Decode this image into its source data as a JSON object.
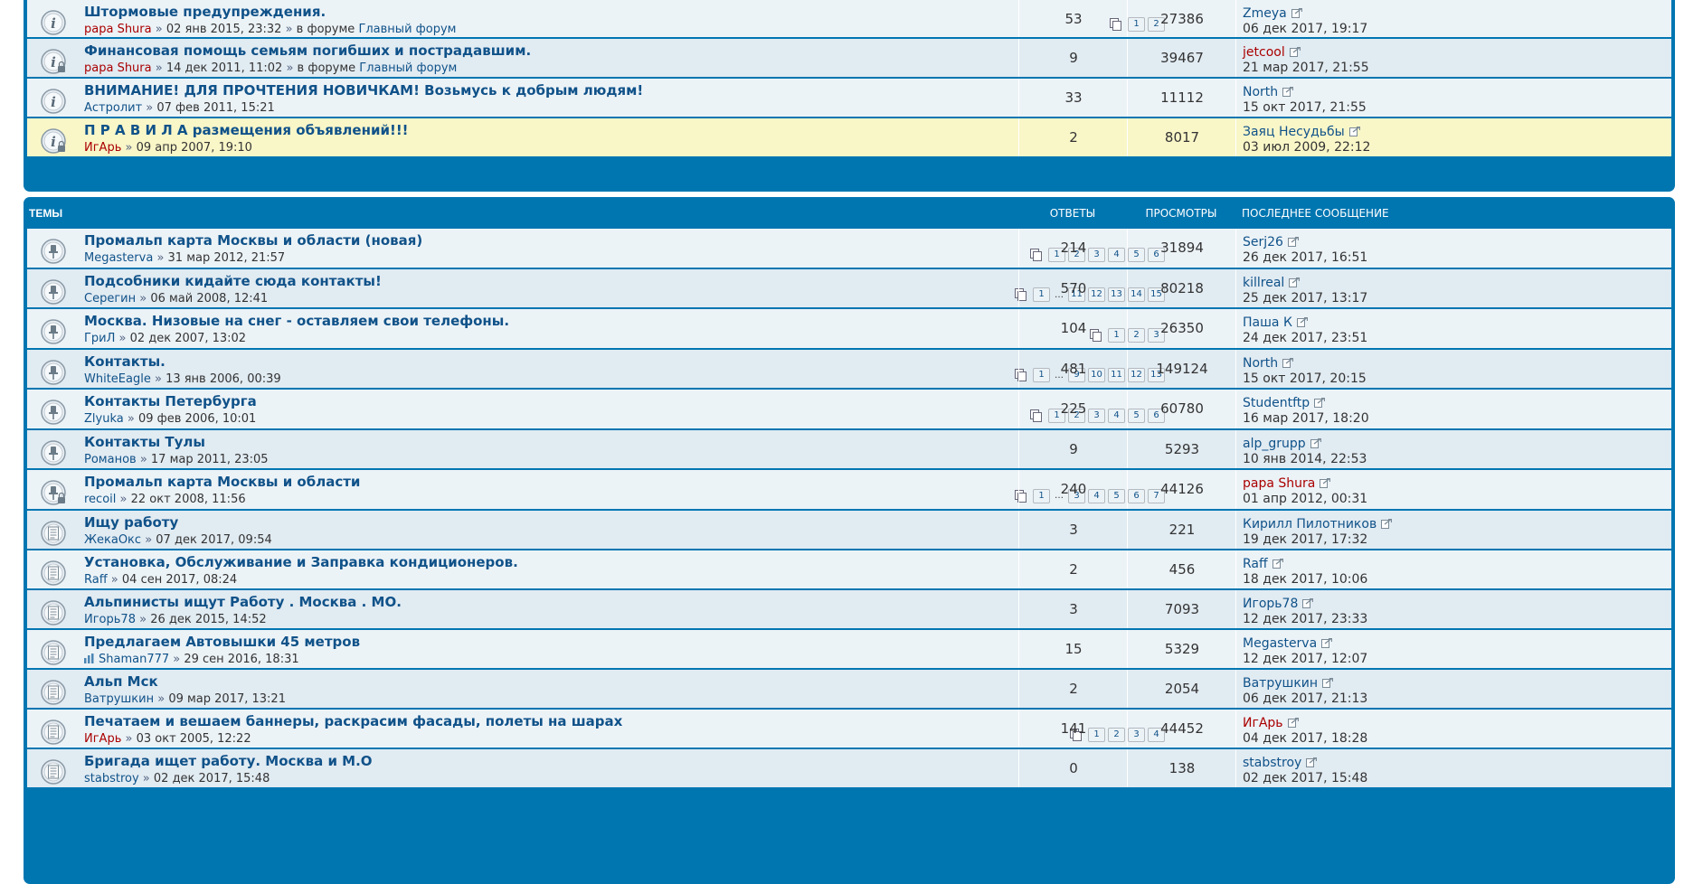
{
  "announcements": [
    {
      "title": "Штормовые предупреждения.",
      "author": "papa Shura",
      "author_red": true,
      "date": "02 янв 2015, 23:32",
      "forum_prefix": "в форуме",
      "forum": "Главный форум",
      "pages": [
        "1",
        "2"
      ],
      "replies": "53",
      "views": "27386",
      "last_user": "Zmeya",
      "last_user_red": false,
      "last_date": "06 дек 2017, 19:17",
      "icon": "announce-icon",
      "locked": false,
      "sticky": false
    },
    {
      "title": "Финансовая помощь семьям погибших и пострадавшим.",
      "author": "papa Shura",
      "author_red": true,
      "date": "14 дек 2011, 11:02",
      "forum_prefix": "в форуме",
      "forum": "Главный форум",
      "pages": [],
      "replies": "9",
      "views": "39467",
      "last_user": "jetcool",
      "last_user_red": true,
      "last_date": "21 мар 2017, 21:55",
      "icon": "announce-locked-icon",
      "locked": true,
      "sticky": false
    },
    {
      "title": "ВНИМАНИЕ! ДЛЯ ПРОЧТЕНИЯ НОВИЧКАМ! Возьмусь к добрым людям!",
      "author": "Астролит",
      "author_red": false,
      "date": "07 фев 2011, 15:21",
      "forum_prefix": "",
      "forum": "",
      "pages": [],
      "replies": "33",
      "views": "11112",
      "last_user": "North",
      "last_user_red": false,
      "last_date": "15 окт 2017, 21:55",
      "icon": "announce-icon",
      "locked": false,
      "sticky": false
    },
    {
      "title": "П Р А В И Л А размещения объявлений!!!",
      "author": "ИгАрь",
      "author_red": true,
      "date": "09 апр 2007, 19:10",
      "forum_prefix": "",
      "forum": "",
      "pages": [],
      "replies": "2",
      "views": "8017",
      "last_user": "Заяц Несудьбы",
      "last_user_red": false,
      "last_date": "03 июл 2009, 22:12",
      "icon": "announce-locked-icon",
      "locked": true,
      "sticky": true
    }
  ],
  "header": {
    "topics": "ТЕМЫ",
    "replies": "ОТВЕТЫ",
    "views": "ПРОСМОТРЫ",
    "last_post": "ПОСЛЕДНЕЕ СООБЩЕНИЕ"
  },
  "topics": [
    {
      "title": "Промальп карта Москвы и области (новая)",
      "author": "Megasterva",
      "author_red": false,
      "date": "31 мар 2012, 21:57",
      "pages": [
        "1",
        "2",
        "3",
        "4",
        "5",
        "6"
      ],
      "replies": "214",
      "views": "31894",
      "last_user": "Serj26",
      "last_user_red": false,
      "last_date": "26 дек 2017, 16:51",
      "icon": "sticky-icon",
      "locked": false
    },
    {
      "title": "Подсобники кидайте сюда контакты!",
      "author": "Серегин",
      "author_red": false,
      "date": "06 май 2008, 12:41",
      "pages": [
        "1",
        "…",
        "11",
        "12",
        "13",
        "14",
        "15"
      ],
      "replies": "570",
      "views": "80218",
      "last_user": "killreal",
      "last_user_red": false,
      "last_date": "25 дек 2017, 13:17",
      "icon": "sticky-icon",
      "locked": false
    },
    {
      "title": "Москва. Низовые на снег - оставляем свои телефоны.",
      "author": "ГриЛ",
      "author_red": false,
      "date": "02 дек 2007, 13:02",
      "pages": [
        "1",
        "2",
        "3"
      ],
      "replies": "104",
      "views": "26350",
      "last_user": "Паша К",
      "last_user_red": false,
      "last_date": "24 дек 2017, 23:51",
      "icon": "sticky-icon",
      "locked": false
    },
    {
      "title": "Контакты.",
      "author": "WhiteEagle",
      "author_red": false,
      "date": "13 янв 2006, 00:39",
      "pages": [
        "1",
        "…",
        "9",
        "10",
        "11",
        "12",
        "13"
      ],
      "replies": "481",
      "views": "149124",
      "last_user": "North",
      "last_user_red": false,
      "last_date": "15 окт 2017, 20:15",
      "icon": "sticky-icon",
      "locked": false
    },
    {
      "title": "Контакты Петербурга",
      "author": "Zlyuka",
      "author_red": false,
      "date": "09 фев 2006, 10:01",
      "pages": [
        "1",
        "2",
        "3",
        "4",
        "5",
        "6"
      ],
      "replies": "225",
      "views": "60780",
      "last_user": "Studentftp",
      "last_user_red": false,
      "last_date": "16 мар 2017, 18:20",
      "icon": "sticky-icon",
      "locked": false
    },
    {
      "title": "Контакты Тулы",
      "author": "Романов",
      "author_red": false,
      "date": "17 мар 2011, 23:05",
      "pages": [],
      "replies": "9",
      "views": "5293",
      "last_user": "alp_grupp",
      "last_user_red": false,
      "last_date": "10 янв 2014, 22:53",
      "icon": "sticky-icon",
      "locked": false
    },
    {
      "title": "Промальп карта Москвы и области",
      "author": "recoil",
      "author_red": false,
      "date": "22 окт 2008, 11:56",
      "pages": [
        "1",
        "…",
        "3",
        "4",
        "5",
        "6",
        "7"
      ],
      "replies": "240",
      "views": "44126",
      "last_user": "papa Shura",
      "last_user_red": true,
      "last_date": "01 апр 2012, 00:31",
      "icon": "sticky-locked-icon",
      "locked": true
    },
    {
      "title": "Ищу работу",
      "author": "ЖекаОкс",
      "author_red": false,
      "date": "07 дек 2017, 09:54",
      "pages": [],
      "replies": "3",
      "views": "221",
      "last_user": "Кирилл Пилотников",
      "last_user_red": false,
      "last_date": "19 дек 2017, 17:32",
      "icon": "topic-icon",
      "locked": false
    },
    {
      "title": "Установка, Обслуживание и Заправка кондиционеров.",
      "author": "Raff",
      "author_red": false,
      "date": "04 сен 2017, 08:24",
      "pages": [],
      "replies": "2",
      "views": "456",
      "last_user": "Raff",
      "last_user_red": false,
      "last_date": "18 дек 2017, 10:06",
      "icon": "topic-icon",
      "locked": false
    },
    {
      "title": "Альпинисты ищут Работу . Москва . МО.",
      "author": "Игорь78",
      "author_red": false,
      "date": "26 дек 2015, 14:52",
      "pages": [],
      "replies": "3",
      "views": "7093",
      "last_user": "Игорь78",
      "last_user_red": false,
      "last_date": "12 дек 2017, 23:33",
      "icon": "topic-icon",
      "locked": false
    },
    {
      "title": "Предлагаем Автовышки 45 метров",
      "author": "Shaman777",
      "author_red": false,
      "date": "29 сен 2016, 18:31",
      "pages": [],
      "replies": "15",
      "views": "5329",
      "last_user": "Megasterva",
      "last_user_red": false,
      "last_date": "12 дек 2017, 12:07",
      "icon": "topic-icon",
      "locked": false,
      "poll": true
    },
    {
      "title": "Альп Мск",
      "author": "Ватрушкин",
      "author_red": false,
      "date": "09 мар 2017, 13:21",
      "pages": [],
      "replies": "2",
      "views": "2054",
      "last_user": "Ватрушкин",
      "last_user_red": false,
      "last_date": "06 дек 2017, 21:13",
      "icon": "topic-icon",
      "locked": false
    },
    {
      "title": "Печатаем и вешаем баннеры, раскрасим фасады, полеты на шарах",
      "author": "ИгАрь",
      "author_red": true,
      "date": "03 окт 2005, 12:22",
      "pages": [
        "1",
        "2",
        "3",
        "4"
      ],
      "replies": "141",
      "views": "44452",
      "last_user": "ИгАрь",
      "last_user_red": true,
      "last_date": "04 дек 2017, 18:28",
      "icon": "topic-icon",
      "locked": false
    },
    {
      "title": "Бригада ищет работу. Москва и М.О",
      "author": "stabstroy",
      "author_red": false,
      "date": "02 дек 2017, 15:48",
      "pages": [],
      "replies": "0",
      "views": "138",
      "last_user": "stabstroy",
      "last_user_red": false,
      "last_date": "02 дек 2017, 15:48",
      "icon": "topic-icon",
      "locked": false
    }
  ],
  "colors": {
    "accent": "#0076b1",
    "link": "#105289",
    "red_user": "#aa0000",
    "row_bg": "#ecf3f7",
    "row_alt": "#e1ebf2",
    "sticky_bg": "#f9f6c8"
  }
}
